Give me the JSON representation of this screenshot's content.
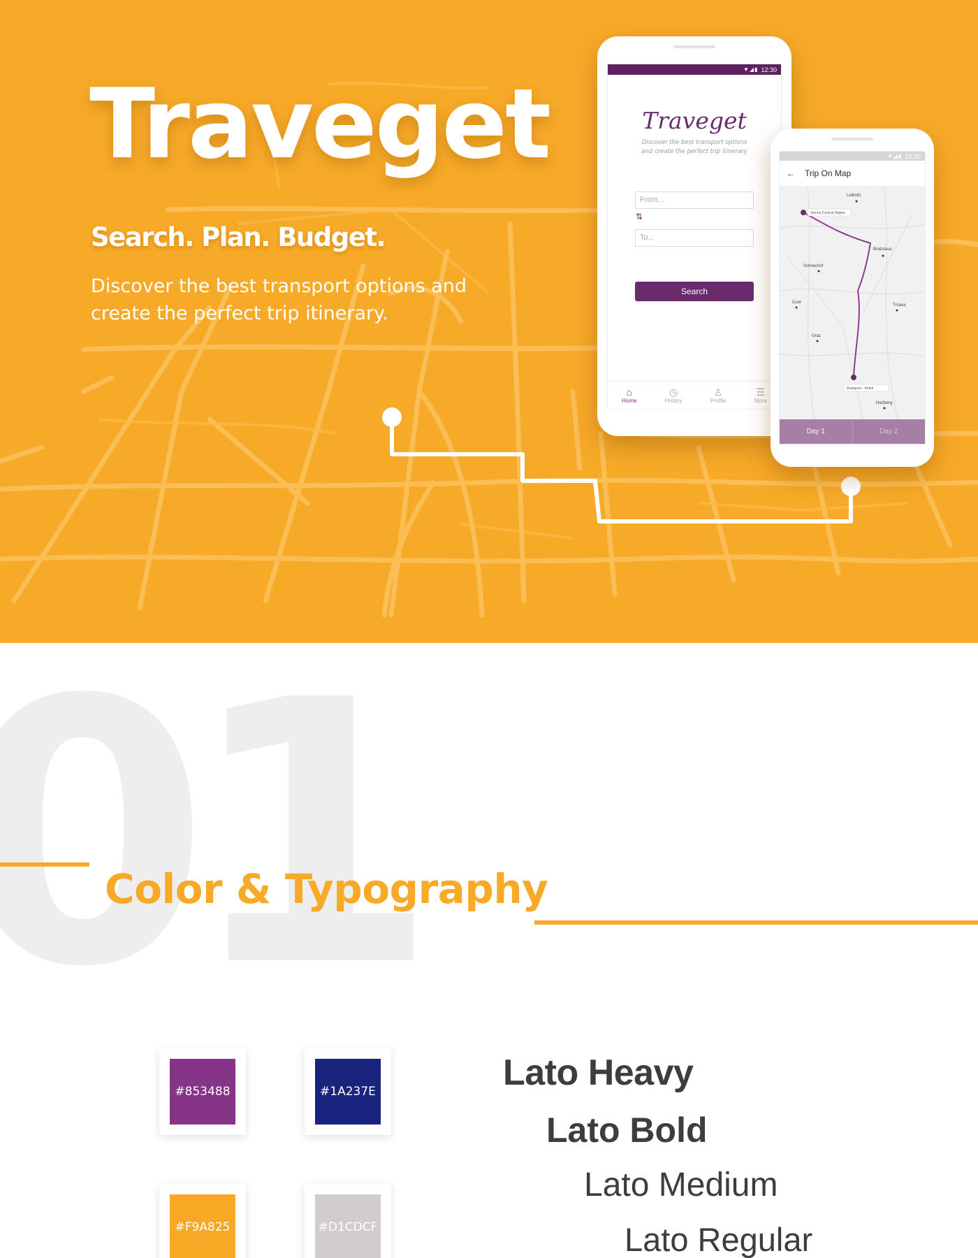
{
  "hero": {
    "title": "Traveget",
    "tagline": "Search. Plan. Budget.",
    "description": "Discover the best transport options and create the perfect trip itinerary.",
    "background_color": "#F7A928"
  },
  "phone_home": {
    "status_time": "12:30",
    "app_logo": "Traveget",
    "app_subtitle": "Discover the best transport options and create the perfect trip itinerary",
    "from_placeholder": "From...",
    "to_placeholder": "To...",
    "search_label": "Search",
    "nav": [
      {
        "label": "Home",
        "icon": "home-icon"
      },
      {
        "label": "History",
        "icon": "history-icon"
      },
      {
        "label": "Profile",
        "icon": "profile-icon"
      },
      {
        "label": "More",
        "icon": "menu-icon"
      }
    ],
    "accent_color": "#6A2B6D"
  },
  "phone_map": {
    "status_time": "12:30",
    "title": "Trip On Map",
    "cities": [
      "Leibnitz",
      "Bratislava",
      "Schnechof",
      "Cuor",
      "Trnava",
      "Graz",
      "Hartberg"
    ],
    "start_station": "Vienna Central Station",
    "end_station": "Budapest - Keleti",
    "tabs": [
      "Day 1",
      "Day 2"
    ]
  },
  "section": {
    "number": "01",
    "title": "Color & Typography"
  },
  "colors": [
    {
      "hex": "#853488",
      "label": "#853488"
    },
    {
      "hex": "#1A237E",
      "label": "#1A237E"
    },
    {
      "hex": "#F9A825",
      "label": "#F9A825"
    },
    {
      "hex": "#D1CDCF",
      "label": "#D1CDCF"
    }
  ],
  "typography": [
    "Lato Heavy",
    "Lato Bold",
    "Lato Medium",
    "Lato Regular"
  ]
}
